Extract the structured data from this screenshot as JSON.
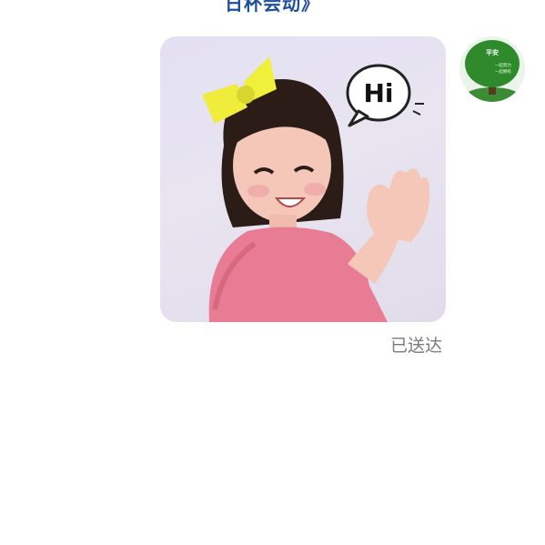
{
  "header": {
    "link_text": "日杯会动》"
  },
  "message": {
    "sticker_caption": "Hi",
    "delivery_status": "已送达"
  },
  "avatar": {
    "title": "平安",
    "line1": "一起努力",
    "line2": "一起拥有"
  },
  "colors": {
    "link": "#1f4f9a",
    "status_text": "#7a7a7a",
    "sticker_bg": "#e3e0f2",
    "dress": "#e87c94",
    "bow": "#f0ec3c",
    "avatar_tree": "#2f8a2c"
  }
}
